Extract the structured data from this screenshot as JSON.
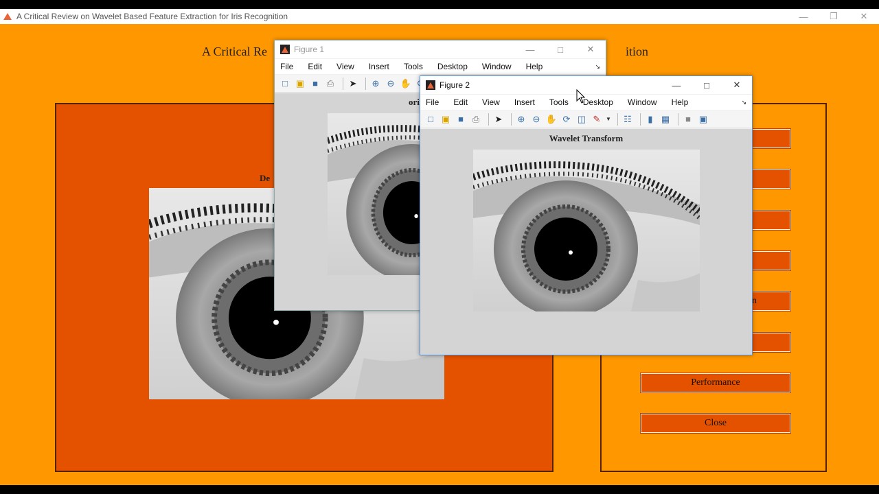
{
  "main_window": {
    "title": "A Critical Review on Wavelet Based Feature Extraction for Iris Recognition",
    "heading_visible_left": "A Critical Re",
    "heading_visible_right": "ition",
    "left_panel_label": "De",
    "buttons": [
      {
        "label": ""
      },
      {
        "label": ""
      },
      {
        "label": ""
      },
      {
        "label": ""
      },
      {
        "label": "n"
      },
      {
        "label": ""
      },
      {
        "label": "Performance"
      },
      {
        "label": "Close"
      }
    ]
  },
  "figure1": {
    "title": "Figure 1",
    "menu": [
      "File",
      "Edit",
      "View",
      "Insert",
      "Tools",
      "Desktop",
      "Window",
      "Help"
    ],
    "axes_title": "ori"
  },
  "figure2": {
    "title": "Figure 2",
    "menu": [
      "File",
      "Edit",
      "View",
      "Insert",
      "Tools",
      "Desktop",
      "Window",
      "Help"
    ],
    "axes_title": "Wavelet Transform"
  },
  "colors": {
    "background": "#ff9800",
    "panel": "#e45200",
    "button": "#e45200",
    "yellow_patch": "#e8e000"
  }
}
